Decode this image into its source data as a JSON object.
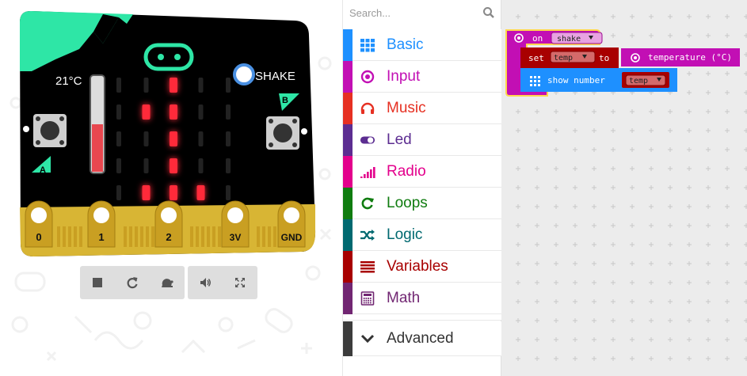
{
  "simulator": {
    "temperature_reading": "21°C",
    "temperature_level": 0.5,
    "shake_label": "SHAKE",
    "button_a_label": "A",
    "button_b_label": "B",
    "pins": [
      "0",
      "1",
      "2",
      "3V",
      "GND"
    ],
    "led_matrix": [
      [
        0,
        0,
        1,
        0,
        0
      ],
      [
        0,
        1,
        1,
        0,
        0
      ],
      [
        0,
        0,
        1,
        0,
        0
      ],
      [
        0,
        0,
        1,
        0,
        0
      ],
      [
        0,
        1,
        1,
        1,
        0
      ]
    ],
    "colors": {
      "board": "#000000",
      "accent": "#2ee6a6",
      "led_on": "#ff2a3a",
      "led_off": "#222222",
      "pin": "#d8b534"
    },
    "controls": [
      {
        "name": "stop-button",
        "icon": "stop-icon"
      },
      {
        "name": "restart-button",
        "icon": "restart-icon"
      },
      {
        "name": "slow-motion-button",
        "icon": "snail-icon"
      },
      {
        "name": "mute-button",
        "icon": "speaker-icon"
      },
      {
        "name": "fullscreen-button",
        "icon": "expand-icon"
      }
    ]
  },
  "toolbox": {
    "search_placeholder": "Search...",
    "categories": [
      {
        "label": "Basic",
        "color": "#1e90ff",
        "icon": "grid-icon"
      },
      {
        "label": "Input",
        "color": "#c20fb4",
        "icon": "target-icon"
      },
      {
        "label": "Music",
        "color": "#e63022",
        "icon": "headphones-icon"
      },
      {
        "label": "Led",
        "color": "#5c2d91",
        "icon": "toggle-icon"
      },
      {
        "label": "Radio",
        "color": "#e3008c",
        "icon": "signal-bars-icon"
      },
      {
        "label": "Loops",
        "color": "#107c10",
        "icon": "refresh-icon"
      },
      {
        "label": "Logic",
        "color": "#006970",
        "icon": "shuffle-icon"
      },
      {
        "label": "Variables",
        "color": "#a80000",
        "icon": "lines-icon"
      },
      {
        "label": "Math",
        "color": "#712672",
        "icon": "calculator-icon"
      }
    ],
    "advanced": {
      "label": "Advanced",
      "color": "#3c3c3c",
      "icon": "chevron-down-icon"
    }
  },
  "workspace": {
    "event_block": {
      "on": "on",
      "event": "shake"
    },
    "set_block": {
      "keyword": "set",
      "variable": "temp",
      "to": "to",
      "value": "temperature (°C)"
    },
    "show_block": {
      "label": "show number",
      "variable": "temp"
    },
    "colors": {
      "input": "#c20fb4",
      "input_dark": "#9b0c90",
      "variables": "#a80000",
      "variables_dark": "#800000",
      "basic": "#1e90ff",
      "basic_dark": "#1a72c8",
      "highlight": "#ffd74c"
    }
  }
}
